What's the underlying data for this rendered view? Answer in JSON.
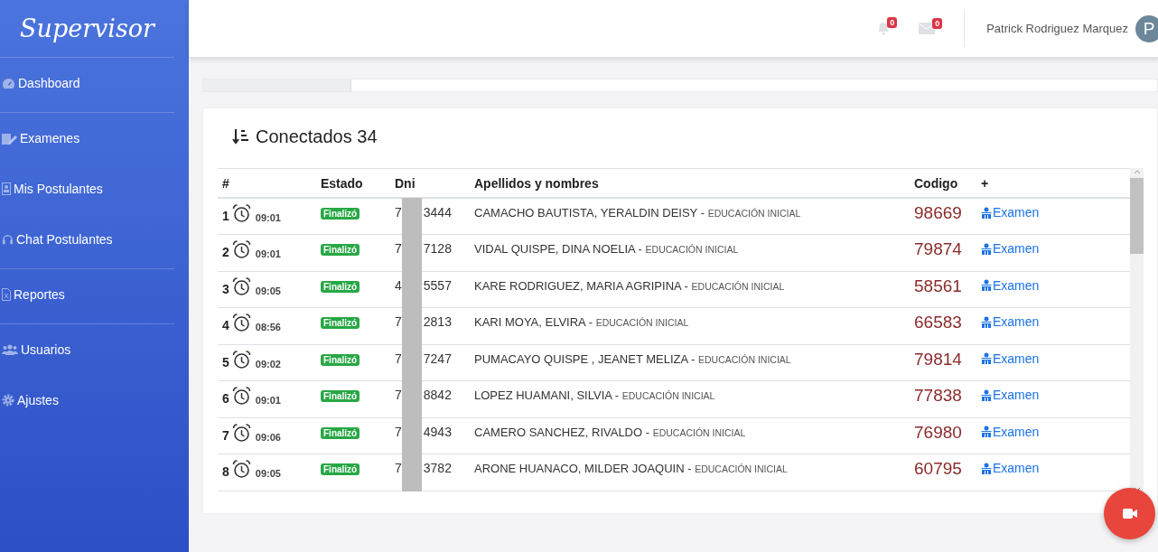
{
  "brand": "Supervisor",
  "sidebar": {
    "groups": [
      {
        "items": [
          {
            "label": "Dashboard"
          }
        ]
      },
      {
        "items": [
          {
            "label": "Examenes"
          },
          {
            "label": "Mis Postulantes"
          },
          {
            "label": "Chat Postulantes"
          }
        ]
      },
      {
        "items": [
          {
            "label": "Reportes"
          }
        ]
      },
      {
        "items": [
          {
            "label": "Usuarios"
          },
          {
            "label": "Ajustes"
          }
        ]
      }
    ]
  },
  "header": {
    "notifications_badge": "0",
    "messages_badge": "0",
    "user_name": "Patrick Rodriguez Marquez",
    "avatar_letter": "P"
  },
  "panel": {
    "title": "Conectados 34",
    "columns": [
      "#",
      "Estado",
      "Dni",
      "Apellidos y nombres",
      "Codigo",
      "+"
    ],
    "rows": [
      {
        "number": "1",
        "time": "09:01",
        "status": "Finalizó",
        "dni_start": "7",
        "dni_end": "3444",
        "name": "CAMACHO BAUTISTA, YERALDIN DEISY -",
        "program": "EDUCACIÓN INICIAL",
        "code": "98669",
        "action": "Examen"
      },
      {
        "number": "2",
        "time": "09:01",
        "status": "Finalizó",
        "dni_start": "7",
        "dni_end": "7128",
        "name": "VIDAL QUISPE, DINA NOELIA -",
        "program": "EDUCACIÓN INICIAL",
        "code": "79874",
        "action": "Examen"
      },
      {
        "number": "3",
        "time": "09:05",
        "status": "Finalizó",
        "dni_start": "4",
        "dni_end": "5557",
        "name": "KARE RODRIGUEZ, MARIA AGRIPINA -",
        "program": "EDUCACIÓN INICIAL",
        "code": "58561",
        "action": "Examen"
      },
      {
        "number": "4",
        "time": "08:56",
        "status": "Finalizó",
        "dni_start": "7",
        "dni_end": "2813",
        "name": "KARI MOYA, ELVIRA -",
        "program": "EDUCACIÓN INICIAL",
        "code": "66583",
        "action": "Examen"
      },
      {
        "number": "5",
        "time": "09:02",
        "status": "Finalizó",
        "dni_start": "7",
        "dni_end": "7247",
        "name": "PUMACAYO QUISPE , JEANET MELIZA -",
        "program": "EDUCACIÓN INICIAL",
        "code": "79814",
        "action": "Examen"
      },
      {
        "number": "6",
        "time": "09:01",
        "status": "Finalizó",
        "dni_start": "7",
        "dni_end": "8842",
        "name": "LOPEZ HUAMANI, SILVIA -",
        "program": "EDUCACIÓN INICIAL",
        "code": "77838",
        "action": "Examen"
      },
      {
        "number": "7",
        "time": "09:06",
        "status": "Finalizó",
        "dni_start": "7",
        "dni_end": "4943",
        "name": "CAMERO SANCHEZ, RIVALDO -",
        "program": "EDUCACIÓN INICIAL",
        "code": "76980",
        "action": "Examen"
      },
      {
        "number": "8",
        "time": "09:05",
        "status": "Finalizó",
        "dni_start": "7",
        "dni_end": "3782",
        "name": "ARONE HUANACO, MILDER JOAQUIN -",
        "program": "EDUCACIÓN INICIAL",
        "code": "60795",
        "action": "Examen"
      }
    ]
  }
}
